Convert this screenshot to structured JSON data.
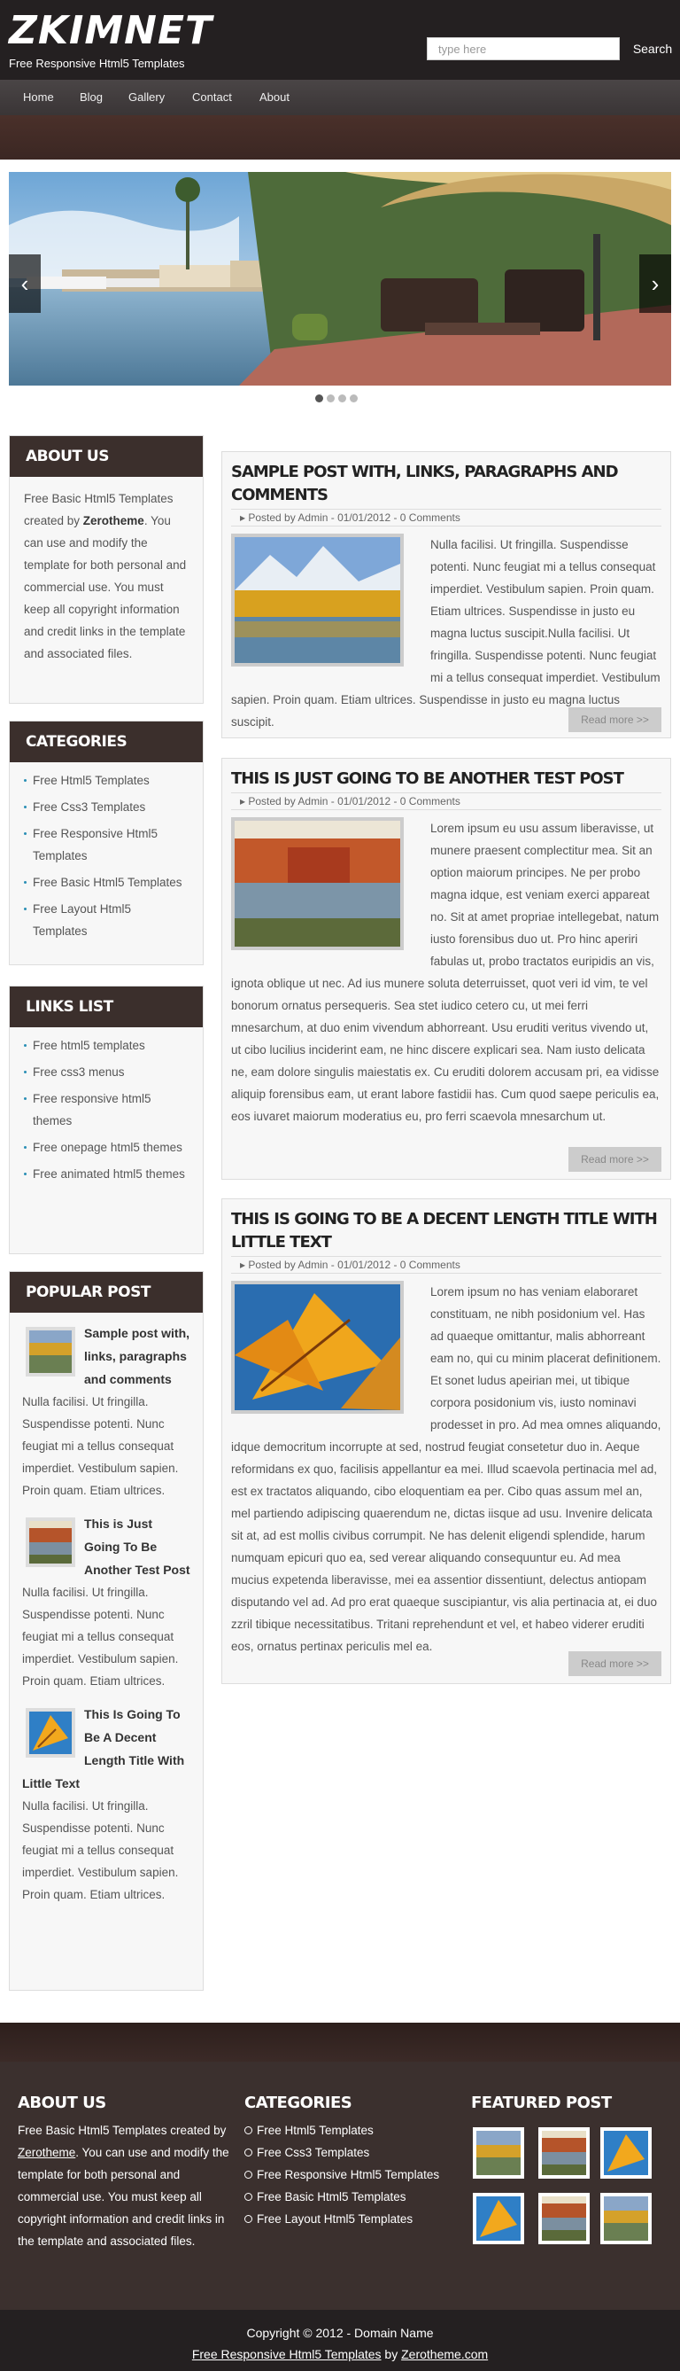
{
  "header": {
    "logo": "ZKIMNET",
    "tagline": "Free Responsive Html5 Templates",
    "search_placeholder": "type here",
    "search_button": "Search"
  },
  "nav": [
    "Home",
    "Blog",
    "Gallery",
    "Contact",
    "About"
  ],
  "slider": {
    "dots": 4,
    "active_dot": 1
  },
  "sidebar": {
    "about": {
      "title": "ABOUT US",
      "text_before": "Free Basic Html5 Templates created by ",
      "link": "Zerotheme",
      "text_after": ". You can use and modify the template for both personal and commercial use. You must keep all copyright information and credit links in the template and associated files."
    },
    "categories": {
      "title": "CATEGORIES",
      "items": [
        "Free Html5 Templates",
        "Free Css3 Templates",
        "Free Responsive Html5 Templates",
        "Free Basic Html5 Templates",
        "Free Layout Html5 Templates"
      ]
    },
    "links": {
      "title": "LINKS LIST",
      "items": [
        "Free html5 templates",
        "Free css3 menus",
        "Free responsive html5 themes",
        "Free onepage html5 themes",
        "Free animated html5 themes"
      ]
    },
    "popular": {
      "title": "POPULAR POST",
      "items": [
        {
          "title": "Sample post with, links, paragraphs and comments",
          "text": "Nulla facilisi. Ut fringilla. Suspendisse potenti. Nunc feugiat mi a tellus consequat imperdiet. Vestibulum sapien. Proin quam. Etiam ultrices."
        },
        {
          "title": "This is Just Going To Be Another Test Post",
          "text": "Nulla facilisi. Ut fringilla. Suspendisse potenti. Nunc feugiat mi a tellus consequat imperdiet. Vestibulum sapien. Proin quam. Etiam ultrices."
        },
        {
          "title": "This Is Going To Be A Decent Length Title With Little Text",
          "text": "Nulla facilisi. Ut fringilla. Suspendisse potenti. Nunc feugiat mi a tellus consequat imperdiet. Vestibulum sapien. Proin quam. Etiam ultrices."
        }
      ]
    }
  },
  "posts": [
    {
      "title": "Sample post with, links, paragraphs and comments",
      "meta": "Posted by Admin - 01/01/2012 - 0 Comments",
      "body": "Nulla facilisi. Ut fringilla. Suspendisse potenti. Nunc feugiat mi a tellus consequat imperdiet. Vestibulum sapien. Proin quam. Etiam ultrices. Suspendisse in justo eu magna luctus suscipit.Nulla facilisi. Ut fringilla. Suspendisse potenti. Nunc feugiat mi a tellus consequat imperdiet. Vestibulum sapien. Proin quam. Etiam ultrices. Suspendisse in justo eu magna luctus suscipit.",
      "read_more": "Read more >>"
    },
    {
      "title": "This is just going to be another test post",
      "meta": "Posted by Admin - 01/01/2012 - 0 Comments",
      "body": "Lorem ipsum eu usu assum liberavisse, ut munere praesent complectitur mea. Sit an option maiorum principes. Ne per probo magna idque, est veniam exerci appareat no. Sit at amet propriae intellegebat, natum iusto forensibus duo ut. Pro hinc aperiri fabulas ut, probo tractatos euripidis an vis, ignota oblique ut nec. Ad ius munere soluta deterruisset, quot veri id vim, te vel bonorum ornatus persequeris. Sea stet iudico cetero cu, ut mei ferri mnesarchum, at duo enim vivendum abhorreant. Usu eruditi veritus vivendo ut, ut cibo lucilius inciderint eam, ne hinc discere explicari sea. Nam iusto delicata ne, eam dolore singulis maiestatis ex. Cu eruditi dolorem accusam pri, ea vidisse aliquip forensibus eam, ut erant labore fastidii has. Cum quod saepe periculis ea, eos iuvaret maiorum moderatius eu, pro ferri scaevola mnesarchum ut.",
      "read_more": "Read more >>"
    },
    {
      "title": "This is going to be a decent length title with little text",
      "meta": "Posted by Admin - 01/01/2012 - 0 Comments",
      "body": "Lorem ipsum no has veniam elaboraret constituam, ne nibh posidonium vel. Has ad quaeque omittantur, malis abhorreant eam no, qui cu minim placerat definitionem. Et sonet ludus apeirian mei, ut tibique corpora posidonium vis, iusto nominavi prodesset in pro. Ad mea omnes aliquando, idque democritum incorrupte at sed, nostrud feugiat consetetur duo in. Aeque reformidans ex quo, facilisis appellantur ea mei. Illud scaevola pertinacia mel ad, est ex tractatos aliquando, cibo eloquentiam ea per. Cibo quas assum mel an, mel partiendo adipiscing quaerendum ne, dictas iisque ad usu. Invenire delicata sit at, ad est mollis civibus corrumpit. Ne has delenit eligendi splendide, harum numquam epicuri quo ea, sed verear aliquando consequuntur eu. Ad mea mucius expetenda liberavisse, mei ea assentior dissentiunt, delectus antiopam disputando vel ad. Ad pro erat quaeque suscipiantur, vis alia pertinacia at, ei duo zzril tibique necessitatibus. Tritani reprehendunt et vel, et habeo viderer eruditi eos, ornatus pertinax periculis mel ea.",
      "read_more": "Read more >>"
    }
  ],
  "footer": {
    "about": {
      "title": "ABOUT US",
      "text_before": "Free Basic Html5 Templates created by ",
      "link": "Zerotheme",
      "text_after": ". You can use and modify the template for both personal and commercial use. You must keep all copyright information and credit links in the template and associated files."
    },
    "categories": {
      "title": "CATEGORIES",
      "items": [
        "Free Html5 Templates",
        "Free Css3 Templates",
        "Free Responsive Html5 Templates",
        "Free Basic Html5 Templates",
        "Free Layout Html5 Templates"
      ]
    },
    "featured": {
      "title": "FEATURED POST"
    }
  },
  "bottom": {
    "copyright": "Copyright © 2012 - Domain Name",
    "link1": "Free Responsive Html5 Templates",
    "by": " by ",
    "link2": "Zerotheme.com"
  }
}
